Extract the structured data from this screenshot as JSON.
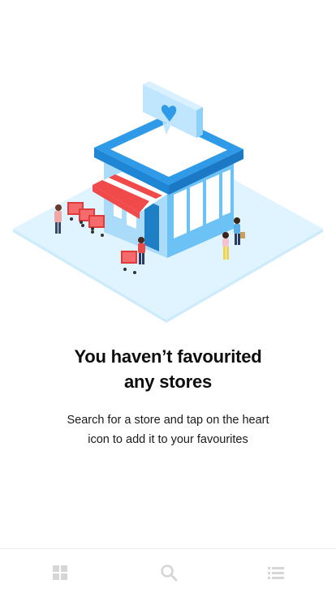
{
  "empty_state": {
    "title_line1": "You haven’t favourited",
    "title_line2": "any stores",
    "message_line1": "Search for a store and tap on the heart",
    "message_line2": "icon to add it to your favourites",
    "illustration": "store-with-heart-illustration"
  },
  "tab_bar": {
    "tabs": [
      {
        "icon": "grid-icon"
      },
      {
        "icon": "search-icon"
      },
      {
        "icon": "list-icon"
      }
    ]
  },
  "colors": {
    "icon_inactive": "#d6d6d6",
    "store_blue": "#2f9ae8",
    "ground_blue": "#dff4fe",
    "awning_red": "#f04a4a"
  }
}
